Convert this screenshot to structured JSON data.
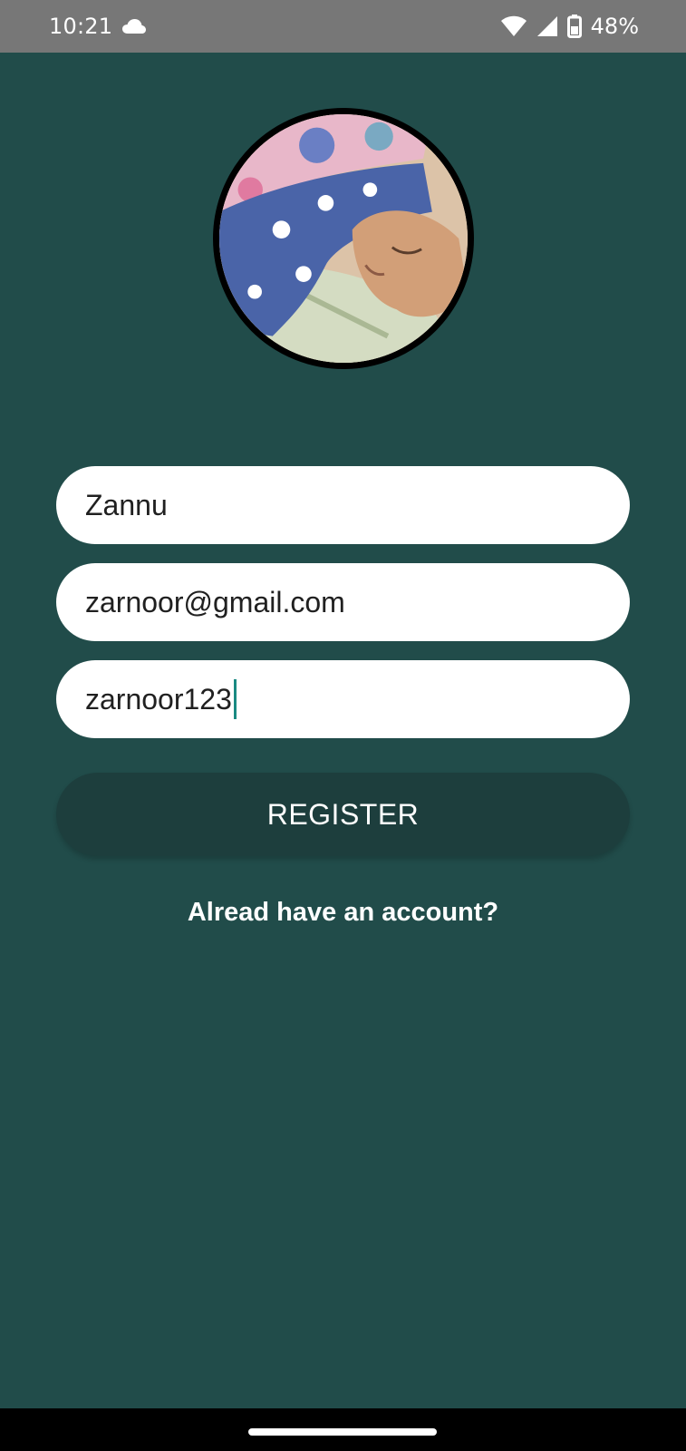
{
  "status_bar": {
    "time": "10:21",
    "battery_percent": "48%",
    "icons": [
      "cloud-icon",
      "wifi-icon",
      "signal-icon",
      "battery-icon"
    ]
  },
  "avatar": {
    "description_icon": "profile-photo"
  },
  "form": {
    "name_value": "Zannu",
    "email_value": "zarnoor@gmail.com",
    "password_value": "zarnoor123"
  },
  "register_label": "REGISTER",
  "login_link_text": "Alread have an account?",
  "colors": {
    "background": "#214c4a",
    "button": "#1d3e3d",
    "status_bar": "#777777",
    "caret": "#1a8a82"
  }
}
